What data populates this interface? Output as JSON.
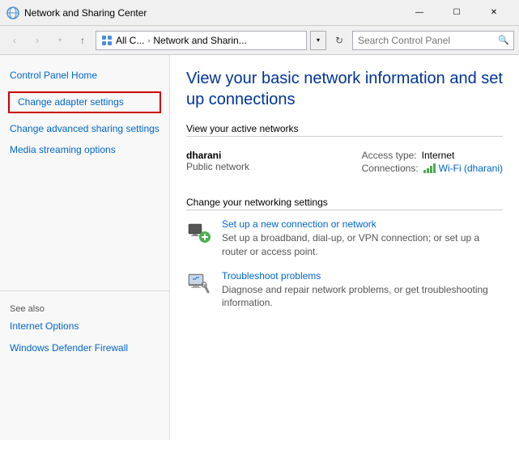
{
  "titlebar": {
    "icon": "🌐",
    "title": "Network and Sharing Center",
    "min_label": "—",
    "max_label": "☐",
    "close_label": "✕"
  },
  "addressbar": {
    "back_icon": "‹",
    "forward_icon": "›",
    "up_icon": "↑",
    "all_c_label": "All C...",
    "separator1": "›",
    "path_label": "Network and Sharin...",
    "dropdown_icon": "▾",
    "refresh_icon": "↻",
    "search_placeholder": "Search Control Panel",
    "search_icon": "🔍"
  },
  "sidebar": {
    "home_label": "Control Panel Home",
    "adapter_label": "Change adapter settings",
    "advanced_label": "Change advanced sharing settings",
    "media_label": "Media streaming options",
    "see_also": "See also",
    "internet_options": "Internet Options",
    "firewall_label": "Windows Defender Firewall"
  },
  "content": {
    "page_title": "View your basic network information and set up connections",
    "active_networks_heading": "View your active networks",
    "network_name": "dharani",
    "network_type": "Public network",
    "access_label": "Access type:",
    "access_value": "Internet",
    "connections_label": "Connections:",
    "wifi_label": "Wi-Fi (dharani)",
    "networking_heading": "Change your networking settings",
    "setup_link": "Set up a new connection or network",
    "setup_desc": "Set up a broadband, dial-up, or VPN connection; or set up a router or access point.",
    "troubleshoot_link": "Troubleshoot problems",
    "troubleshoot_desc": "Diagnose and repair network problems, or get troubleshooting information."
  },
  "colors": {
    "link": "#0066cc",
    "accent": "#003399",
    "border_highlight": "#cc0000",
    "wifi_green": "#4CAF50",
    "text_secondary": "#555555"
  }
}
